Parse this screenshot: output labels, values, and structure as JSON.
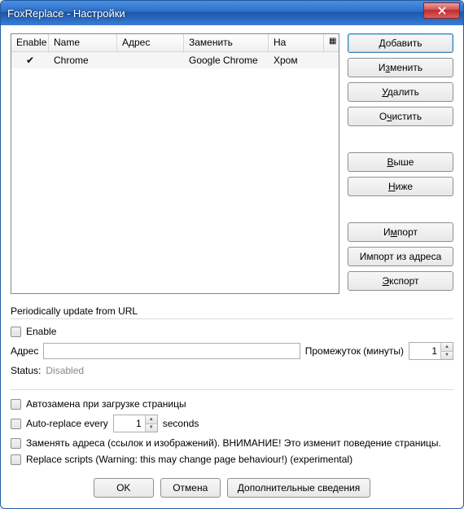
{
  "window": {
    "title": "FoxReplace - Настройки"
  },
  "table": {
    "headers": {
      "enable": "Enable",
      "name": "Name",
      "addr": "Адрес",
      "replace": "Заменить",
      "with": "На",
      "picker": "▦"
    },
    "rows": [
      {
        "enabled": "✔",
        "name": "Chrome",
        "addr": "",
        "replace": "Google Chrome",
        "with": "Хром"
      }
    ]
  },
  "side": {
    "add": "Добавить",
    "edit": "Изменить",
    "delete": "Удалить",
    "clear": "Очистить",
    "up": "Выше",
    "down": "Ниже",
    "import": "Импорт",
    "import_url": "Импорт из адреса",
    "export": "Экспорт"
  },
  "periodic": {
    "title": "Periodically update from URL",
    "enable_label": "Enable",
    "addr_label": "Адрес",
    "addr_value": "",
    "interval_label": "Промежуток (минуты)",
    "interval_value": "1",
    "status_label": "Status:",
    "status_value": "Disabled"
  },
  "opts": {
    "auto_on_load": "Автозамена при загрузке страницы",
    "auto_every_prefix": "Auto-replace every",
    "auto_every_value": "1",
    "auto_every_suffix": "seconds",
    "replace_urls": "Заменять адреса (ссылок и изображений). ВНИМАНИЕ! Это изменит поведение страницы.",
    "replace_scripts": "Replace scripts (Warning: this may change page behaviour!) (experimental)"
  },
  "footer": {
    "ok": "OK",
    "cancel": "Отмена",
    "more": "Дополнительные сведения"
  }
}
